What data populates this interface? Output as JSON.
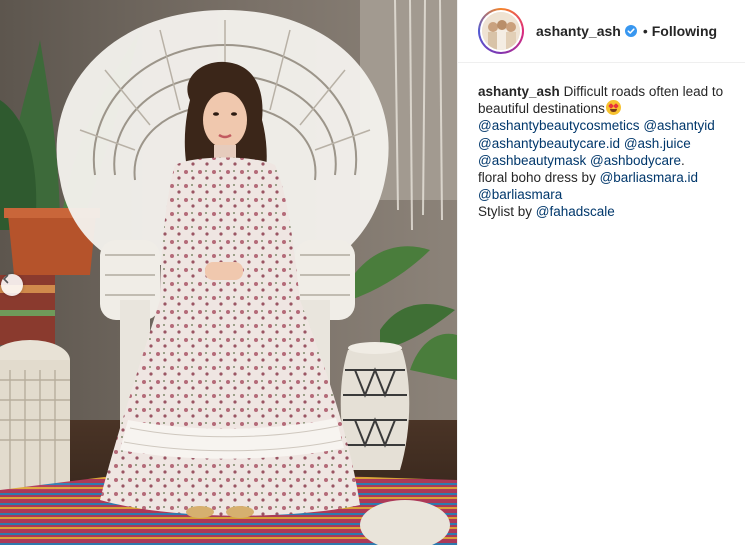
{
  "header": {
    "username": "ashanty_ash",
    "verified_icon": "verified-badge-icon",
    "separator": "•",
    "follow_label": "Following",
    "accent": "#3897f0"
  },
  "caption": {
    "username": "ashanty_ash",
    "line1": "Difficult roads often lead to",
    "line2": "beautiful destinations",
    "emoji": "star-struck-emoji",
    "mention1": "@ashantybeautycosmetics",
    "mention2": "@ashantyid",
    "mention3": "@ashantybeautycare.id",
    "mention4": "@ash.juice",
    "mention5": "@ashbeautymask",
    "mention6": "@ashbodycare",
    "period": ".",
    "dress_text": "floral boho dress by ",
    "mention7": "@barliasmara.id",
    "mention8": "@barliasmara",
    "stylist_text": "Stylist by ",
    "mention9": "@fahadscale"
  },
  "photo": {
    "prev_icon": "chevron-left-icon"
  }
}
